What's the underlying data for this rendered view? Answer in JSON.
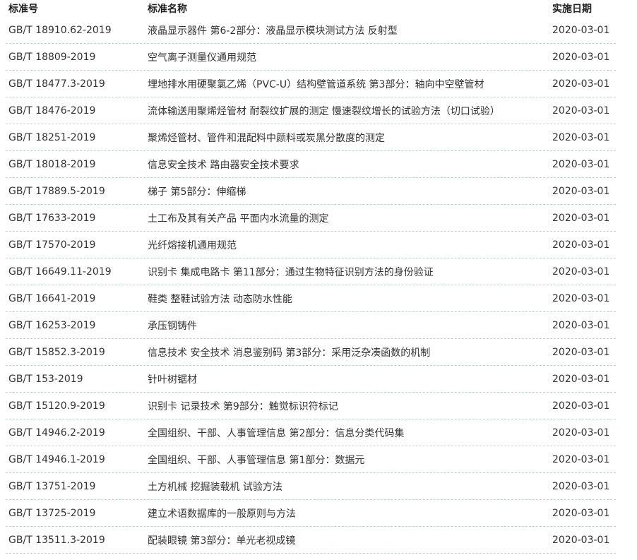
{
  "table": {
    "headers": {
      "code": "标准号",
      "name": "标准名称",
      "date": "实施日期"
    },
    "rows": [
      {
        "code": "GB/T 18910.62-2019",
        "name": "液晶显示器件 第6-2部分：液晶显示模块测试方法 反射型",
        "date": "2020-03-01"
      },
      {
        "code": "GB/T 18809-2019",
        "name": "空气离子测量仪通用规范",
        "date": "2020-03-01"
      },
      {
        "code": "GB/T 18477.3-2019",
        "name": "埋地排水用硬聚氯乙烯（PVC-U）结构壁管道系统 第3部分：轴向中空壁管材",
        "date": "2020-03-01"
      },
      {
        "code": "GB/T 18476-2019",
        "name": "流体输送用聚烯烃管材 耐裂纹扩展的测定 慢速裂纹增长的试验方法（切口试验）",
        "date": "2020-03-01"
      },
      {
        "code": "GB/T 18251-2019",
        "name": "聚烯烃管材、管件和混配料中颜料或炭黑分散度的测定",
        "date": "2020-03-01"
      },
      {
        "code": "GB/T 18018-2019",
        "name": "信息安全技术 路由器安全技术要求",
        "date": "2020-03-01"
      },
      {
        "code": "GB/T 17889.5-2019",
        "name": "梯子 第5部分：伸缩梯",
        "date": "2020-03-01"
      },
      {
        "code": "GB/T 17633-2019",
        "name": "土工布及其有关产品 平面内水流量的测定",
        "date": "2020-03-01"
      },
      {
        "code": "GB/T 17570-2019",
        "name": "光纤熔接机通用规范",
        "date": "2020-03-01"
      },
      {
        "code": "GB/T 16649.11-2019",
        "name": "识别卡 集成电路卡 第11部分：通过生物特征识别方法的身份验证",
        "date": "2020-03-01"
      },
      {
        "code": "GB/T 16641-2019",
        "name": "鞋类 整鞋试验方法 动态防水性能",
        "date": "2020-03-01"
      },
      {
        "code": "GB/T 16253-2019",
        "name": "承压钢铸件",
        "date": "2020-03-01"
      },
      {
        "code": "GB/T 15852.3-2019",
        "name": "信息技术 安全技术 消息鉴别码 第3部分：采用泛杂凑函数的机制",
        "date": "2020-03-01"
      },
      {
        "code": "GB/T 153-2019",
        "name": "针叶树锯材",
        "date": "2020-03-01"
      },
      {
        "code": "GB/T 15120.9-2019",
        "name": "识别卡 记录技术 第9部分：触觉标识符标记",
        "date": "2020-03-01"
      },
      {
        "code": "GB/T 14946.2-2019",
        "name": "全国组织、干部、人事管理信息 第2部分：信息分类代码集",
        "date": "2020-03-01"
      },
      {
        "code": "GB/T 14946.1-2019",
        "name": "全国组织、干部、人事管理信息 第1部分：数据元",
        "date": "2020-03-01"
      },
      {
        "code": "GB/T 13751-2019",
        "name": "土方机械 挖掘装载机 试验方法",
        "date": "2020-03-01"
      },
      {
        "code": "GB/T 13725-2019",
        "name": "建立术语数据库的一般原则与方法",
        "date": "2020-03-01"
      },
      {
        "code": "GB/T 13511.3-2019",
        "name": "配装眼镜 第3部分：单光老视成镜",
        "date": "2020-03-01"
      }
    ]
  },
  "colors": {
    "text": "#333333",
    "header_text": "#222222",
    "row_separator": "#b6d2e6"
  }
}
